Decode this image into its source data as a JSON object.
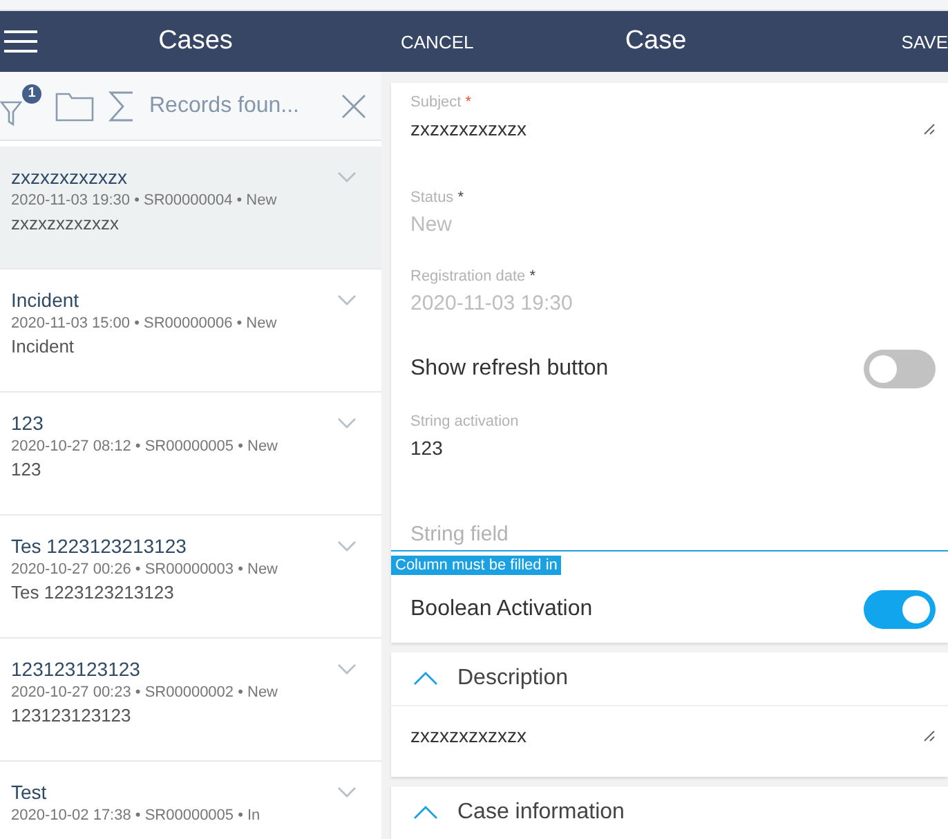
{
  "header": {
    "left_title": "Cases",
    "cancel": "CANCEL",
    "title": "Case",
    "save": "SAVE"
  },
  "toolbar": {
    "filter_count": "1",
    "records_text": "Records foun..."
  },
  "cases": [
    {
      "title": "zxzxzxzxzxzx",
      "meta": "2020-11-03 19:30 • SR00000004 • New",
      "description": "zxzxzxzxzxzx",
      "selected": true
    },
    {
      "title": "Incident",
      "meta": "2020-11-03 15:00 • SR00000006 • New",
      "description": "Incident",
      "selected": false
    },
    {
      "title": "123",
      "meta": "2020-10-27 08:12 • SR00000005 • New",
      "description": "123",
      "selected": false
    },
    {
      "title": "Tes 1223123213123",
      "meta": "2020-10-27 00:26 • SR00000003 • New",
      "description": "Tes 1223123213123",
      "selected": false
    },
    {
      "title": "123123123123",
      "meta": "2020-10-27 00:23 • SR00000002 • New",
      "description": "123123123123",
      "selected": false
    },
    {
      "title": "Test",
      "meta": "2020-10-02 17:38 • SR00000005 • In",
      "selected": false
    }
  ],
  "fields": [
    {
      "kind": "textarea",
      "label": "Subject",
      "required_mark": "*",
      "disabled": false,
      "value": "zxzxzxzxzxzx"
    },
    {
      "kind": "text",
      "label": "Status",
      "required_mark": "*",
      "disabled": true,
      "value": "New"
    },
    {
      "kind": "text",
      "label": "Registration date",
      "required_mark": "*",
      "disabled": true,
      "value": "2020-11-03 19:30"
    },
    {
      "kind": "toggle",
      "label": "Show refresh button",
      "on": false
    },
    {
      "kind": "text",
      "label": "String activation",
      "value": "123"
    },
    {
      "kind": "text",
      "label": "String field",
      "error": "Column must be filled in"
    },
    {
      "kind": "toggle",
      "label": "Boolean Activation",
      "on": true
    }
  ],
  "sections": [
    {
      "title": "Description",
      "expanded": true,
      "value": "zxzxzxzxzxzx"
    },
    {
      "title": "Case information",
      "expanded": true
    }
  ]
}
